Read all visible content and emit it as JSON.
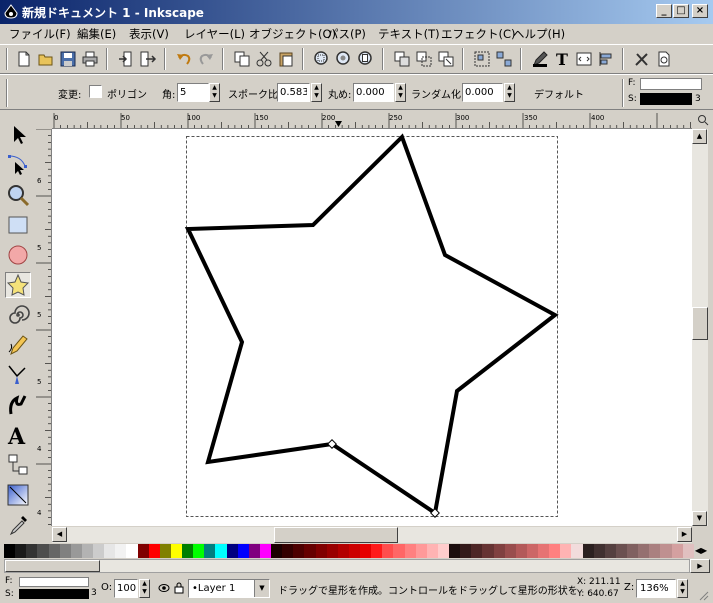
{
  "window": {
    "title": "新規ドキュメント 1 - Inkscape",
    "buttons": [
      "_",
      "□",
      "×"
    ]
  },
  "menu": [
    "ファイル(F)",
    "編集(E)",
    "表示(V)",
    "レイヤー(L)",
    "オブジェクト(O)",
    "パス(P)",
    "テキスト(T)",
    "エフェクト(C)",
    "ヘルプ(H)"
  ],
  "icons": {
    "commands": [
      "new-document-icon",
      "open-icon",
      "save-icon",
      "print-icon",
      "import-icon",
      "export-icon",
      "undo-icon",
      "redo-icon",
      "copy-icon",
      "cut-icon",
      "paste-icon",
      "zoom-selection-icon",
      "zoom-drawing-icon",
      "zoom-page-icon",
      "duplicate-icon",
      "clone-icon",
      "unlink-clone-icon",
      "group-icon",
      "ungroup-icon",
      "fill-stroke-icon",
      "text-font-icon",
      "xml-editor-icon",
      "align-icon",
      "preferences-icon",
      "document-properties-icon"
    ],
    "tools": [
      "selector-icon",
      "node-editor-icon",
      "zoom-icon",
      "rectangle-icon",
      "ellipse-icon",
      "star-icon",
      "spiral-icon",
      "pencil-icon",
      "pen-icon",
      "calligraphy-icon",
      "text-icon",
      "connector-icon",
      "gradient-icon",
      "dropper-icon"
    ]
  },
  "controls": {
    "change_label": "変更:",
    "polygon_label": "ポリゴン",
    "corners_label": "角:",
    "corners_value": "5",
    "spoke_label": "スポーク比:",
    "spoke_value": "0.583",
    "rounded_label": "丸め:",
    "rounded_value": "0.000",
    "random_label": "ランダム化:",
    "random_value": "0.000",
    "default_label": "デフォルト",
    "fill_label": "F:",
    "stroke_label": "S:",
    "stroke_width": "3",
    "fill_color": "#ffffff",
    "stroke_color": "#000000"
  },
  "rulers": {
    "horizontal": [
      "0",
      "50",
      "100",
      "150",
      "200",
      "250",
      "300",
      "350",
      "400"
    ],
    "vertical": [
      "6",
      "5",
      "5",
      "5",
      "4",
      "4"
    ]
  },
  "palette": [
    "#000000",
    "#1a1a1a",
    "#333333",
    "#4d4d4d",
    "#666666",
    "#808080",
    "#999999",
    "#b3b3b3",
    "#cccccc",
    "#e6e6e6",
    "#f2f2f2",
    "#ffffff",
    "#800000",
    "#ff0000",
    "#808000",
    "#ffff00",
    "#008000",
    "#00ff00",
    "#008080",
    "#00ffff",
    "#000080",
    "#0000ff",
    "#800080",
    "#ff00ff",
    "#1a0000",
    "#330000",
    "#4d0000",
    "#660000",
    "#800000",
    "#990000",
    "#b30000",
    "#cc0000",
    "#e60000",
    "#ff1a1a",
    "#ff4d4d",
    "#ff6666",
    "#ff8080",
    "#ff9999",
    "#ffb3b3",
    "#ffcccc",
    "#1a0d0d",
    "#331a1a",
    "#4d2626",
    "#663333",
    "#804040",
    "#994d4d",
    "#b35959",
    "#cc6666",
    "#e67373",
    "#ff8080",
    "#ffb3b3",
    "#f2dcdc",
    "#2b2020",
    "#403030",
    "#554040",
    "#6b5050",
    "#806060",
    "#957070",
    "#aa8080",
    "#bf9090",
    "#d4a0a0",
    "#e0c0c0"
  ],
  "status": {
    "fill_label": "F:",
    "stroke_label": "S:",
    "stroke_width": "3",
    "opacity_label": "O:",
    "opacity_value": "100",
    "layer": "•Layer 1",
    "message": "ドラッグで星形を作成。コントロールをドラッグして星形の形状を…",
    "x_coord": "X: 211.11",
    "y_coord": "Y: 640.67",
    "zoom_label": "Z:",
    "zoom_value": "136%"
  }
}
